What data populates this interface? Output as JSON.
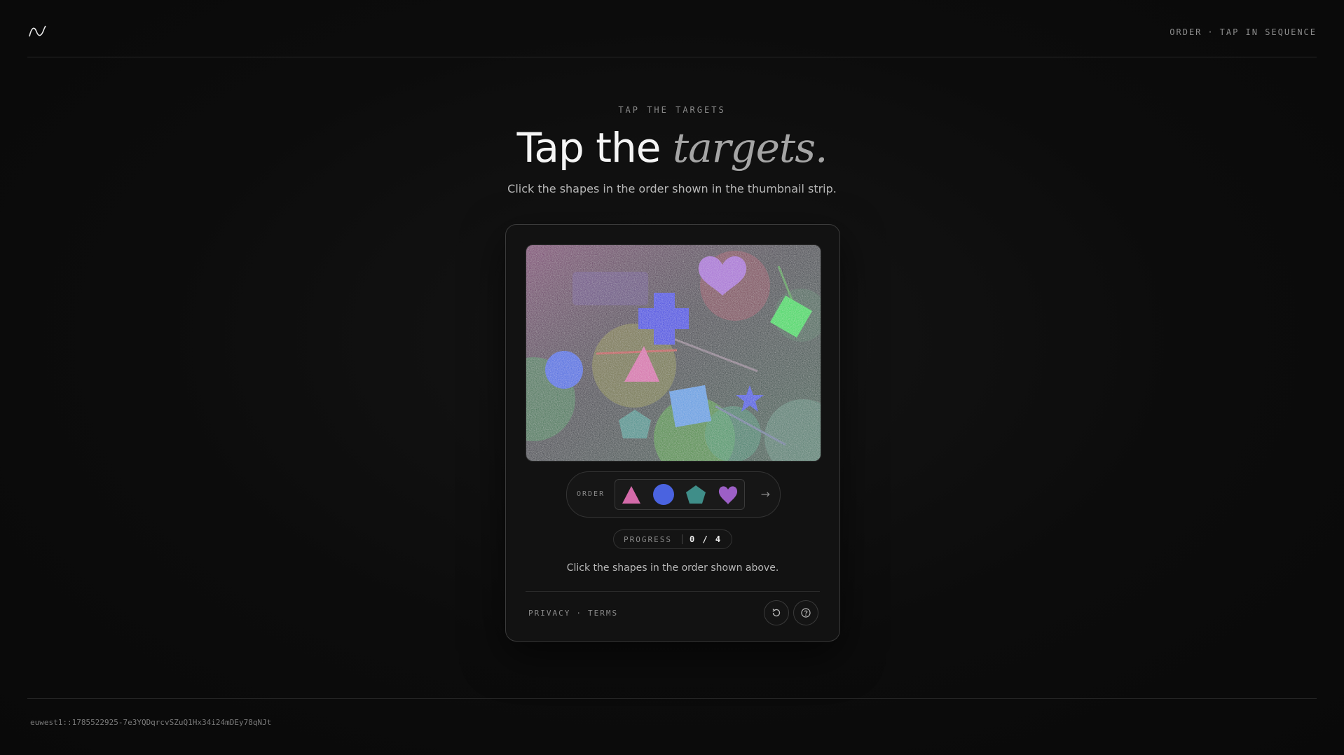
{
  "header": {
    "logo_icon": "wave-logo-icon",
    "mode": "ORDER",
    "instruction": "TAP IN SEQUENCE"
  },
  "hero": {
    "eyebrow": "TAP THE TARGETS",
    "title_plain": "Tap the ",
    "title_emphasis": "targets.",
    "subtitle": "Click the shapes in the order shown in the thumbnail strip."
  },
  "challenge": {
    "canvas_shapes": [
      "heart",
      "cross",
      "diamond",
      "circle",
      "triangle",
      "square",
      "star",
      "pentagon"
    ],
    "order_label": "ORDER",
    "order_sequence": [
      {
        "shape": "triangle",
        "color": "#d46aa9"
      },
      {
        "shape": "circle",
        "color": "#4a63e0"
      },
      {
        "shape": "pentagon",
        "color": "#3f8e89"
      },
      {
        "shape": "heart",
        "color": "#9c5fc6"
      }
    ],
    "next_icon": "arrow-right-icon",
    "progress_label": "PROGRESS",
    "progress_value": "0 / 4",
    "instruction": "Click the shapes in the order shown above."
  },
  "footer": {
    "privacy": "PRIVACY",
    "terms": "TERMS",
    "reload_icon": "reload-icon",
    "help_icon": "help-icon",
    "session_id": "euwest1::1785522925-7e3YQDqrcvSZuQ1Hx34i24mDEy78qNJt"
  }
}
